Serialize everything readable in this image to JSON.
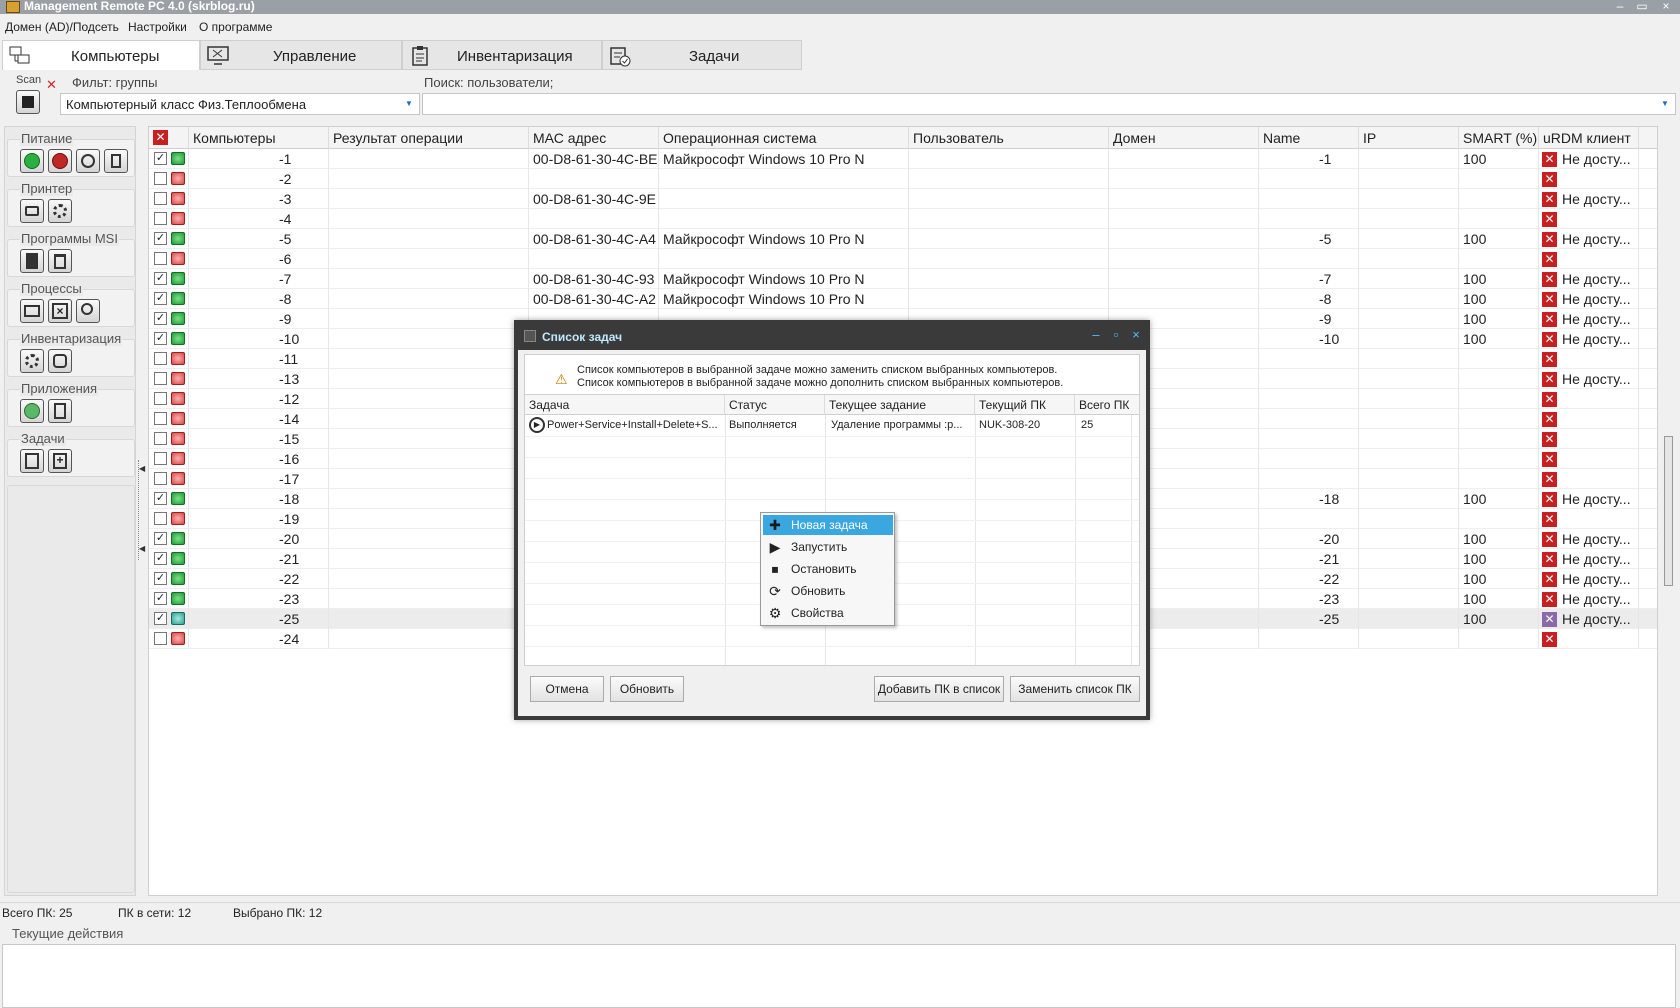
{
  "window": {
    "title": "Management Remote PC 4.0 (skrblog.ru)",
    "minimize": "–",
    "restore": "▭",
    "close": "×"
  },
  "menu": [
    "Домен (AD)/Подсеть",
    "Настройки",
    "О программе"
  ],
  "tabs": [
    {
      "label": "Компьютеры",
      "icon": "computers-icon",
      "active": true
    },
    {
      "label": "Управление",
      "icon": "remote-manage-icon"
    },
    {
      "label": "Инвентаризация",
      "icon": "clipboard-icon"
    },
    {
      "label": "Задачи",
      "icon": "tasks-icon"
    }
  ],
  "scan": {
    "label": "Scan",
    "cancel": "✕"
  },
  "filter": {
    "label": "Фильт: группы",
    "value": "Компьютерный класс Физ.Теплообмена"
  },
  "search": {
    "label": "Поиск: пользователи;",
    "value": ""
  },
  "sidebar": [
    {
      "label": "Питание"
    },
    {
      "label": "Принтер"
    },
    {
      "label": "Программы MSI"
    },
    {
      "label": "Процессы"
    },
    {
      "label": "Инвентаризация"
    },
    {
      "label": "Приложения"
    },
    {
      "label": "Задачи"
    }
  ],
  "grid": {
    "header_x": "✕",
    "columns": [
      "Компьютеры",
      "Результат операции",
      "МАС адрес",
      "Операционная система",
      "Пользователь",
      "Домен",
      "Name",
      "IP",
      "SMART (%)",
      "uRDM клиент"
    ],
    "rows": [
      {
        "checked": true,
        "status": "on",
        "name": "-1",
        "mac": "00-D8-61-30-4C-BE",
        "os": "Майкрософт Windows 10 Pro N",
        "n2": "-1",
        "smart": "100",
        "urdm": "Не досту..."
      },
      {
        "checked": false,
        "status": "off",
        "name": "-2",
        "mac": "",
        "os": "",
        "n2": "",
        "smart": "",
        "urdm": ""
      },
      {
        "checked": false,
        "status": "off",
        "name": "-3",
        "mac": "00-D8-61-30-4C-9E",
        "os": "",
        "n2": "",
        "smart": "",
        "urdm": "Не досту..."
      },
      {
        "checked": false,
        "status": "off",
        "name": "-4",
        "mac": "",
        "os": "",
        "n2": "",
        "smart": "",
        "urdm": ""
      },
      {
        "checked": true,
        "status": "on",
        "name": "-5",
        "mac": "00-D8-61-30-4C-A4",
        "os": "Майкрософт Windows 10 Pro N",
        "n2": "-5",
        "smart": "100",
        "urdm": "Не досту..."
      },
      {
        "checked": false,
        "status": "off",
        "name": "-6",
        "mac": "",
        "os": "",
        "n2": "",
        "smart": "",
        "urdm": ""
      },
      {
        "checked": true,
        "status": "on",
        "name": "-7",
        "mac": "00-D8-61-30-4C-93",
        "os": "Майкрософт Windows 10 Pro N",
        "n2": "-7",
        "smart": "100",
        "urdm": "Не досту..."
      },
      {
        "checked": true,
        "status": "on",
        "name": "-8",
        "mac": "00-D8-61-30-4C-A2",
        "os": "Майкрософт Windows 10 Pro N",
        "n2": "-8",
        "smart": "100",
        "urdm": "Не досту..."
      },
      {
        "checked": true,
        "status": "on",
        "name": "-9",
        "mac": "",
        "os": "",
        "n2": "-9",
        "smart": "100",
        "urdm": "Не досту..."
      },
      {
        "checked": true,
        "status": "on",
        "name": "-10",
        "mac": "",
        "os": "",
        "n2": "-10",
        "smart": "100",
        "urdm": "Не досту..."
      },
      {
        "checked": false,
        "status": "off",
        "name": "-11",
        "mac": "",
        "os": "",
        "n2": "",
        "smart": "",
        "urdm": ""
      },
      {
        "checked": false,
        "status": "off",
        "name": "-13",
        "mac": "",
        "os": "",
        "n2": "",
        "smart": "",
        "urdm": "Не досту..."
      },
      {
        "checked": false,
        "status": "off",
        "name": "-12",
        "mac": "",
        "os": "",
        "n2": "",
        "smart": "",
        "urdm": ""
      },
      {
        "checked": false,
        "status": "off",
        "name": "-14",
        "mac": "",
        "os": "",
        "n2": "",
        "smart": "",
        "urdm": ""
      },
      {
        "checked": false,
        "status": "off",
        "name": "-15",
        "mac": "",
        "os": "",
        "n2": "",
        "smart": "",
        "urdm": ""
      },
      {
        "checked": false,
        "status": "off",
        "name": "-16",
        "mac": "",
        "os": "",
        "n2": "",
        "smart": "",
        "urdm": ""
      },
      {
        "checked": false,
        "status": "off",
        "name": "-17",
        "mac": "",
        "os": "",
        "n2": "",
        "smart": "",
        "urdm": ""
      },
      {
        "checked": true,
        "status": "on",
        "name": "-18",
        "mac": "",
        "os": "",
        "n2": "-18",
        "smart": "100",
        "urdm": "Не досту..."
      },
      {
        "checked": false,
        "status": "off",
        "name": "-19",
        "mac": "",
        "os": "",
        "n2": "",
        "smart": "",
        "urdm": ""
      },
      {
        "checked": true,
        "status": "on",
        "name": "-20",
        "mac": "",
        "os": "",
        "n2": "-20",
        "smart": "100",
        "urdm": "Не досту..."
      },
      {
        "checked": true,
        "status": "on",
        "name": "-21",
        "mac": "",
        "os": "",
        "n2": "-21",
        "smart": "100",
        "urdm": "Не досту..."
      },
      {
        "checked": true,
        "status": "on",
        "name": "-22",
        "mac": "",
        "os": "",
        "n2": "-22",
        "smart": "100",
        "urdm": "Не досту..."
      },
      {
        "checked": true,
        "status": "on",
        "name": "-23",
        "mac": "",
        "os": "",
        "n2": "-23",
        "smart": "100",
        "urdm": "Не досту..."
      },
      {
        "checked": true,
        "status": "rdp",
        "name": "-25",
        "mac": "",
        "os": "",
        "n2": "-25",
        "smart": "100",
        "urdm": "Не досту...",
        "selected": true
      },
      {
        "checked": false,
        "status": "off",
        "name": "-24",
        "mac": "",
        "os": "",
        "n2": "",
        "smart": "",
        "urdm": ""
      }
    ]
  },
  "statusbar": {
    "total": "Всего ПК: 25",
    "online": "ПК в сети: 12",
    "selected": "Выбрано ПК: 12"
  },
  "actions": {
    "label": "Текущие действия"
  },
  "dialog": {
    "title": "Список задач",
    "msg1": "Список компьютеров в выбранной задаче можно заменить списком выбранных компьютеров.",
    "msg2": "Список компьютеров в выбранной задаче можно дополнить списком выбранных компьютеров.",
    "columns": [
      "Задача",
      "Статус",
      "Текущее задание",
      "Текущий ПК",
      "Всего ПК"
    ],
    "task": {
      "name": "Power+Service+Install+Delete+S...",
      "status": "Выполняется",
      "current": "Удаление программы :р...",
      "pc": "NUK-308-20",
      "total": "25"
    },
    "buttons": {
      "cancel": "Отмена",
      "refresh": "Обновить",
      "add": "Добавить ПК в список",
      "replace": "Заменить список ПК"
    }
  },
  "context_menu": [
    {
      "label": "Новая задача",
      "icon": "plus-icon"
    },
    {
      "label": "Запустить",
      "icon": "play-icon"
    },
    {
      "label": "Остановить",
      "icon": "stop-icon"
    },
    {
      "label": "Обновить",
      "icon": "refresh-icon"
    },
    {
      "label": "Свойства",
      "icon": "gear-icon"
    }
  ]
}
